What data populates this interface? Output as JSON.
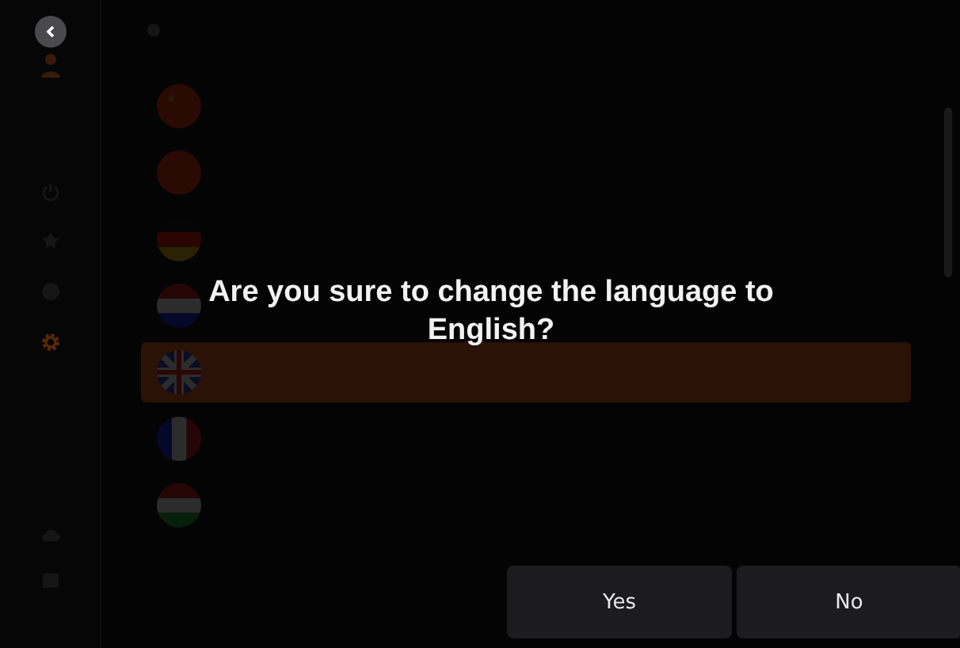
{
  "sidebar": {
    "items": [
      {
        "kind": "power",
        "selected": false
      },
      {
        "kind": "star",
        "selected": false
      },
      {
        "kind": "globe",
        "selected": false
      },
      {
        "kind": "gear",
        "selected": true
      },
      {
        "kind": "cloud",
        "selected": false
      },
      {
        "kind": "box",
        "selected": false
      }
    ]
  },
  "languages": [
    {
      "kind": "cn",
      "selected": false
    },
    {
      "kind": "tw",
      "selected": false
    },
    {
      "kind": "de",
      "selected": false
    },
    {
      "kind": "nl",
      "selected": false
    },
    {
      "kind": "gb",
      "selected": true
    },
    {
      "kind": "fr",
      "selected": false
    },
    {
      "kind": "hu",
      "selected": false
    }
  ],
  "dialog": {
    "message": "Are you sure to change the language to English?",
    "buttons": [
      "Yes",
      "No"
    ]
  }
}
